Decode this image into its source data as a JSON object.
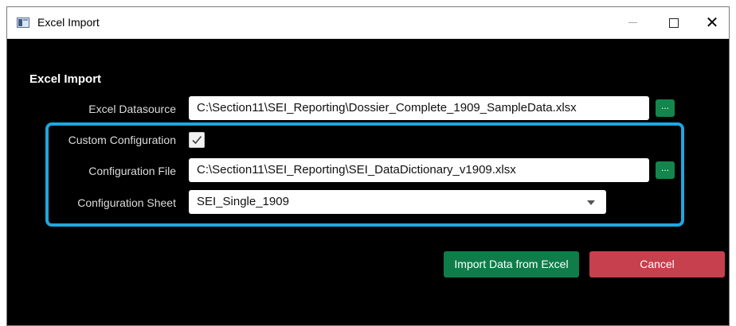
{
  "window": {
    "title": "Excel Import",
    "close_glyph": "✕"
  },
  "form": {
    "section_title": "Excel Import",
    "excel_datasource": {
      "label": "Excel Datasource",
      "value": "C:\\Section11\\SEI_Reporting\\Dossier_Complete_1909_SampleData.xlsx",
      "browse_label": "..."
    },
    "custom_configuration": {
      "label": "Custom Configuration",
      "checked": true
    },
    "configuration_file": {
      "label": "Configuration File",
      "value": "C:\\Section11\\SEI_Reporting\\SEI_DataDictionary_v1909.xlsx",
      "browse_label": "..."
    },
    "configuration_sheet": {
      "label": "Configuration Sheet",
      "selected": "SEI_Single_1909"
    }
  },
  "actions": {
    "import_label": "Import Data from Excel",
    "cancel_label": "Cancel"
  },
  "colors": {
    "highlight": "#1ea7e0",
    "primary_green": "#0f7d4a",
    "cancel_red": "#c7404d"
  }
}
